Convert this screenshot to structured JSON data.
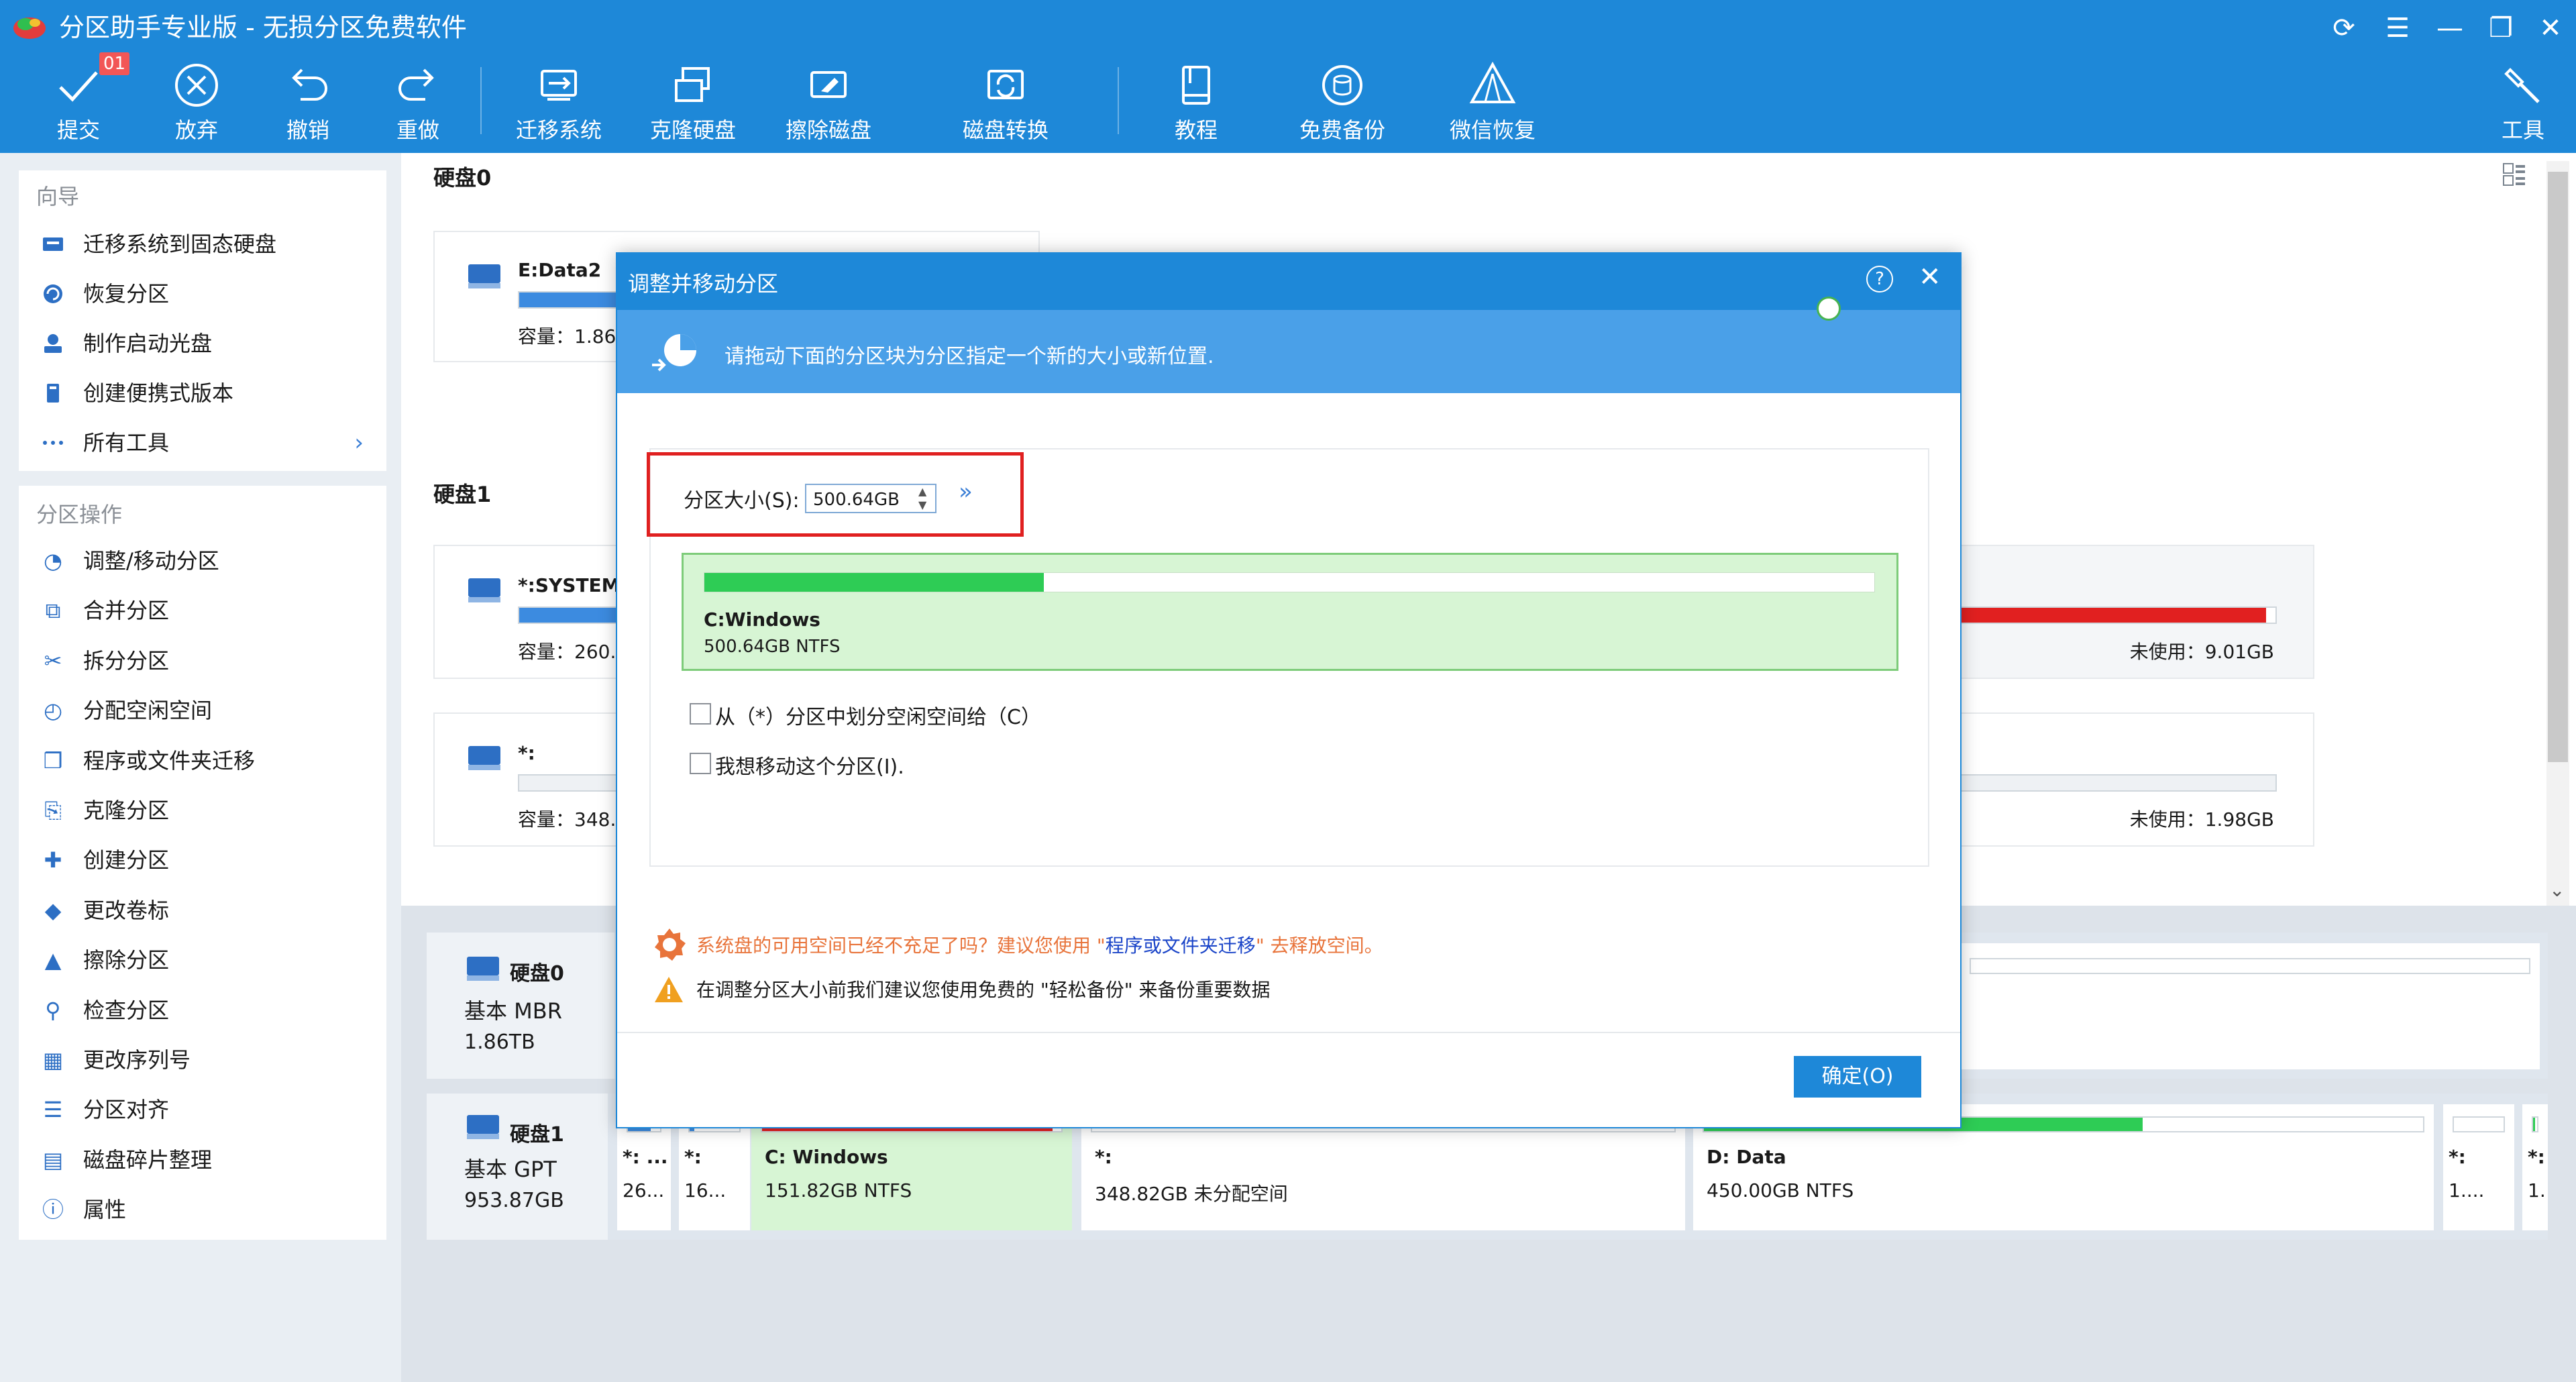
{
  "app": {
    "title": "分区助手专业版 - 无损分区免费软件"
  },
  "toolbar": {
    "badge": "01",
    "buttons": [
      {
        "label": "提交",
        "icon": "check-icon"
      },
      {
        "label": "放弃",
        "icon": "cancel-icon"
      },
      {
        "label": "撤销",
        "icon": "undo-icon"
      },
      {
        "label": "重做",
        "icon": "redo-icon"
      },
      {
        "label": "迁移系统",
        "icon": "migrate-os-icon"
      },
      {
        "label": "克隆硬盘",
        "icon": "clone-disk-icon"
      },
      {
        "label": "擦除磁盘",
        "icon": "wipe-disk-icon"
      },
      {
        "label": "磁盘转换",
        "icon": "disk-convert-icon"
      },
      {
        "label": "教程",
        "icon": "tutorial-icon"
      },
      {
        "label": "免费备份",
        "icon": "backup-icon"
      },
      {
        "label": "微信恢复",
        "icon": "wechat-recovery-icon"
      },
      {
        "label": "工具",
        "icon": "tools-icon"
      }
    ]
  },
  "sidebar": {
    "wizard_title": "向导",
    "wizard_items": [
      {
        "label": "迁移系统到固态硬盘",
        "icon": "ssd-icon"
      },
      {
        "label": "恢复分区",
        "icon": "restore-icon"
      },
      {
        "label": "制作启动光盘",
        "icon": "boot-disc-icon"
      },
      {
        "label": "创建便携式版本",
        "icon": "portable-icon"
      },
      {
        "label": "所有工具",
        "icon": "more-icon"
      }
    ],
    "ops_title": "分区操作",
    "ops_items": [
      {
        "label": "调整/移动分区",
        "icon": "resize-icon"
      },
      {
        "label": "合并分区",
        "icon": "merge-icon"
      },
      {
        "label": "拆分分区",
        "icon": "split-icon"
      },
      {
        "label": "分配空闲空间",
        "icon": "allocate-icon"
      },
      {
        "label": "程序或文件夹迁移",
        "icon": "app-mover-icon"
      },
      {
        "label": "克隆分区",
        "icon": "clone-partition-icon"
      },
      {
        "label": "创建分区",
        "icon": "create-partition-icon"
      },
      {
        "label": "更改卷标",
        "icon": "label-icon"
      },
      {
        "label": "擦除分区",
        "icon": "wipe-partition-icon"
      },
      {
        "label": "检查分区",
        "icon": "check-partition-icon"
      },
      {
        "label": "更改序列号",
        "icon": "serial-icon"
      },
      {
        "label": "分区对齐",
        "icon": "align-icon"
      },
      {
        "label": "磁盘碎片整理",
        "icon": "defrag-icon"
      },
      {
        "label": "属性",
        "icon": "info-icon"
      }
    ]
  },
  "main": {
    "disk0_title": "硬盘0",
    "disk1_title": "硬盘1",
    "cards": {
      "edata2_name": "E:Data2",
      "edata2_cap": "容量：1.86T",
      "system_name": "*:SYSTEM",
      "system_cap": "容量：260.0",
      "star_name": "*:",
      "star_cap": "容量：348.8",
      "right1_unused": "未使用：9.01GB",
      "right2_unused": "未使用：1.98GB"
    },
    "bars": {
      "edata2_fill": 0.35,
      "system_fill": 0.65,
      "right1_fill": 0.97
    }
  },
  "diskmap": {
    "disk0": {
      "name": "硬盘0",
      "type": "基本 MBR",
      "size": "1.86TB"
    },
    "disk1": {
      "name": "硬盘1",
      "type": "基本 GPT",
      "size": "953.87GB"
    },
    "parts": [
      {
        "name": "*: ...",
        "size": "26...",
        "fill": 0.7
      },
      {
        "name": "*:",
        "size": "16...",
        "fill": 0.1
      },
      {
        "name": "C: Windows",
        "size": "151.82GB NTFS",
        "fill": 0.97
      },
      {
        "name": "*:",
        "size": "348.82GB 未分配空间",
        "fill": 0
      },
      {
        "name": "D: Data",
        "size": "450.00GB NTFS",
        "fill": 0.61
      },
      {
        "name": "*:",
        "size": "1....",
        "fill": 0.0
      },
      {
        "name": "*:",
        "size": "1.",
        "fill": 0.5
      }
    ]
  },
  "dialog": {
    "title": "调整并移动分区",
    "banner_text": "请拖动下面的分区块为分区指定一个新的大小或新位置.",
    "size_label": "分区大小(S):",
    "size_value": "500.64GB",
    "partition_name": "C:Windows",
    "partition_info": "500.64GB NTFS",
    "partition_fill": 0.29,
    "checkbox1": "从（*）分区中划分空闲空间给（C）",
    "checkbox2": "我想移动这个分区(I).",
    "tip1_prefix": "系统盘的可用空间已经不充足了吗？建议您使用 \"",
    "tip1_link": "程序或文件夹迁移",
    "tip1_suffix": "\" 去释放空间。",
    "tip2": "在调整分区大小前我们建议您使用免费的 \"轻松备份\" 来备份重要数据",
    "ok_label": "确定(O)",
    "colors": {
      "accent": "#1E88D8",
      "used": "#2ecc55",
      "warn": "#e8743b",
      "link": "#1a44c8"
    }
  }
}
